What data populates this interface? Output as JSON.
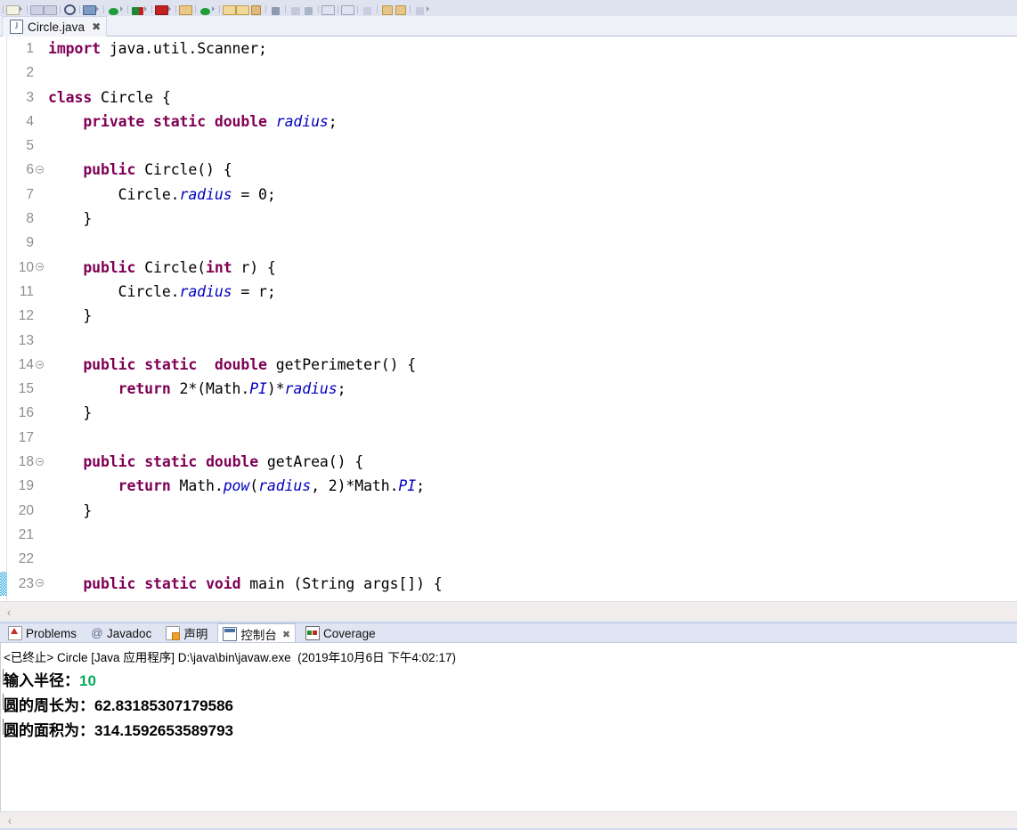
{
  "toolbar": {
    "name": "eclipse-main-toolbar",
    "icons": [
      {
        "name": "new-wizard-icon",
        "color": "#f0f0e0"
      },
      {
        "name": "dropdown-arrow-icon",
        "color": "#8e96ad"
      },
      {
        "name": "save-icon",
        "color": "#c9cfdd"
      },
      {
        "name": "save-all-icon",
        "color": "#c9cfdd"
      },
      {
        "name": "print-icon",
        "color": "#b9c2d6"
      },
      {
        "name": "search-icon",
        "color": "#4a5a7a"
      },
      {
        "name": "open-type-icon",
        "color": "#5a7aa5"
      },
      {
        "name": "run-icon",
        "color": "#1f9d3a"
      },
      {
        "name": "debug-icon",
        "color": "#147a2e"
      },
      {
        "name": "coverage-icon",
        "color": "#17792c"
      },
      {
        "name": "stop-icon",
        "color": "#c32020"
      },
      {
        "name": "terminate-icon",
        "color": "#b81c1c"
      },
      {
        "name": "new-java-project-icon",
        "color": "#e6b86a"
      },
      {
        "name": "new-class-icon",
        "color": "#1f9d3a"
      },
      {
        "name": "open-folder-icon",
        "color": "#e8c37a"
      },
      {
        "name": "open-folder-2-icon",
        "color": "#e8c37a"
      },
      {
        "name": "key-icon",
        "color": "#d8a85a"
      },
      {
        "name": "step-into-icon",
        "color": "#6b7590"
      },
      {
        "name": "step-over-icon",
        "color": "#6b7590"
      },
      {
        "name": "link-icon",
        "color": "#9aa4bb"
      },
      {
        "name": "pin-icon",
        "color": "#8b94ab"
      },
      {
        "name": "editor-icon",
        "color": "#aab2c6"
      },
      {
        "name": "outline-icon",
        "color": "#aab2c6"
      },
      {
        "name": "next-annotation-icon",
        "color": "#9aa4bb"
      },
      {
        "name": "prev-annotation-icon",
        "color": "#9aa4bb"
      },
      {
        "name": "back-icon",
        "color": "#d8b06a"
      },
      {
        "name": "forward-icon",
        "color": "#d8b06a"
      },
      {
        "name": "last-edit-icon",
        "color": "#a7b0c4"
      }
    ]
  },
  "editor_tab": {
    "icon": "java-file-icon",
    "icon_glyph": "J",
    "label": "Circle.java",
    "close_glyph": "✖"
  },
  "code": {
    "lines": [
      {
        "n": "1",
        "fold": false,
        "marker": false
      },
      {
        "n": "2",
        "fold": false,
        "marker": false
      },
      {
        "n": "3",
        "fold": false,
        "marker": false
      },
      {
        "n": "4",
        "fold": false,
        "marker": false
      },
      {
        "n": "5",
        "fold": false,
        "marker": false
      },
      {
        "n": "6",
        "fold": true,
        "marker": false
      },
      {
        "n": "7",
        "fold": false,
        "marker": false
      },
      {
        "n": "8",
        "fold": false,
        "marker": false
      },
      {
        "n": "9",
        "fold": false,
        "marker": false
      },
      {
        "n": "10",
        "fold": true,
        "marker": false
      },
      {
        "n": "11",
        "fold": false,
        "marker": false
      },
      {
        "n": "12",
        "fold": false,
        "marker": false
      },
      {
        "n": "13",
        "fold": false,
        "marker": false
      },
      {
        "n": "14",
        "fold": true,
        "marker": false
      },
      {
        "n": "15",
        "fold": false,
        "marker": false
      },
      {
        "n": "16",
        "fold": false,
        "marker": false
      },
      {
        "n": "17",
        "fold": false,
        "marker": false
      },
      {
        "n": "18",
        "fold": true,
        "marker": false
      },
      {
        "n": "19",
        "fold": false,
        "marker": false
      },
      {
        "n": "20",
        "fold": false,
        "marker": false
      },
      {
        "n": "21",
        "fold": false,
        "marker": false
      },
      {
        "n": "22",
        "fold": false,
        "marker": false
      },
      {
        "n": "23",
        "fold": true,
        "marker": true
      }
    ],
    "text": [
      "import java.util.Scanner;",
      "",
      "class Circle {",
      "    private static double radius;",
      "",
      "    public Circle() {",
      "        Circle.radius = 0;",
      "    }",
      "",
      "    public Circle(int r) {",
      "        Circle.radius = r;",
      "    }",
      "",
      "    public static  double getPerimeter() {",
      "        return 2*(Math.PI)*radius;",
      "    }",
      "",
      "    public static double getArea() {",
      "        return Math.pow(radius, 2)*Math.PI;",
      "    }",
      "",
      "",
      "    public static void main (String args[]) {"
    ],
    "colors": {
      "keyword": "#7f0055",
      "field": "#0000c0",
      "plain": "#000000",
      "line_number": "#8d8d8d",
      "background": "#ffffff"
    }
  },
  "editor_scrollbar": {
    "left_arrow_glyph": "‹"
  },
  "view_tabs": [
    {
      "label": "Problems",
      "icon": "problems-icon",
      "active": false,
      "closeable": false
    },
    {
      "label": "Javadoc",
      "icon": "javadoc-icon",
      "active": false,
      "closeable": false
    },
    {
      "label": "声明",
      "icon": "declaration-icon",
      "active": false,
      "closeable": false
    },
    {
      "label": "控制台",
      "icon": "console-icon",
      "active": true,
      "closeable": true
    },
    {
      "label": "Coverage",
      "icon": "coverage-icon",
      "active": false,
      "closeable": false
    }
  ],
  "view_tab_close_glyph": "✖",
  "console": {
    "header": "<已终止> Circle [Java 应用程序] D:\\java\\bin\\javaw.exe  (2019年10月6日 下午4:02:17)",
    "lines": [
      {
        "prompt": "输入半径：",
        "value": "10",
        "value_color": "#0aab5e",
        "is_input": true
      },
      {
        "prompt": "圆的周长为：",
        "value": "62.83185307179586",
        "value_color": "#000000",
        "is_input": false
      },
      {
        "prompt": "圆的面积为：",
        "value": "314.1592653589793",
        "value_color": "#000000",
        "is_input": false
      }
    ],
    "scrollbar_left_glyph": "‹"
  }
}
